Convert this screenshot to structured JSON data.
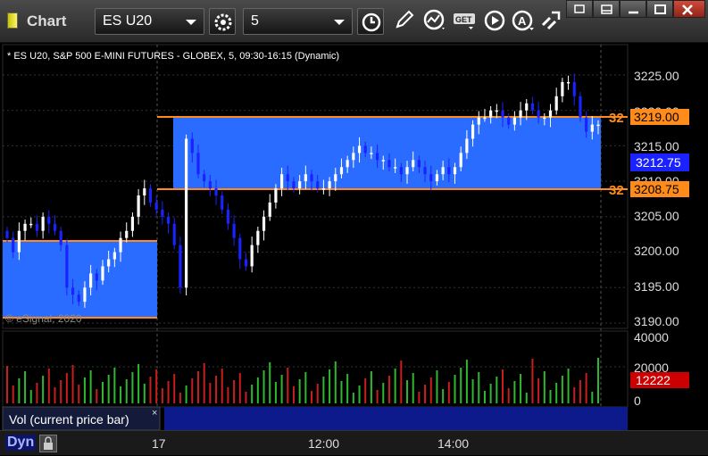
{
  "toolbar": {
    "title": "Chart",
    "symbol": "ES U20",
    "interval": "5"
  },
  "chart": {
    "header": "* ES U20, S&P 500 E-MINI FUTURES - GLOBEX, 5, 09:30-16:15 (Dynamic)",
    "watermark": "© eSignal, 2020",
    "price_labels": [
      "3225.00",
      "3220.00",
      "3215.00",
      "3210.00",
      "3205.00",
      "3200.00",
      "3195.00",
      "3190.00"
    ],
    "upper_tag": "3219.00",
    "lower_tag": "3208.75",
    "current_price": "3212.75",
    "upper_tag_prefix": "32",
    "lower_tag_prefix": "32",
    "zone_color": "#2a6cff",
    "line_color": "#ff8c1a",
    "up_color": "#ffffff",
    "down_color": "#1a22ff"
  },
  "volume": {
    "title": "Vol (current price bar)",
    "labels": [
      "40000",
      "20000",
      "0"
    ],
    "current": "12222",
    "tag_color": "#cc0000"
  },
  "time_axis": {
    "labels": [
      "17",
      "12:00",
      "14:00"
    ]
  },
  "footer": {
    "mode": "Dyn"
  },
  "chart_data": {
    "type": "candlestick",
    "price_axis": [
      3190,
      3225
    ],
    "levels": {
      "resistance": 3219.0,
      "support": 3208.75,
      "prior_high": 3201.5,
      "prior_low": 3190.5,
      "last": 3212.75
    },
    "candles_close": [
      3202,
      3200,
      3203,
      3204,
      3204,
      3203,
      3205,
      3204,
      3203,
      3201,
      3195,
      3194,
      3193,
      3195,
      3197,
      3196,
      3198,
      3199,
      3200,
      3202,
      3203,
      3205,
      3208,
      3209,
      3207,
      3206,
      3205,
      3204,
      3201,
      3195,
      3216,
      3214,
      3211,
      3210,
      3209,
      3208,
      3206,
      3204,
      3202,
      3199,
      3198,
      3201,
      3203,
      3205,
      3207,
      3209,
      3211,
      3210,
      3209,
      3210,
      3211,
      3210,
      3209,
      3209,
      3210,
      3211,
      3212,
      3213,
      3214,
      3215,
      3214,
      3214,
      3213,
      3213,
      3212,
      3212,
      3211,
      3212,
      3213,
      3212,
      3211,
      3210,
      3211,
      3212,
      3211,
      3212,
      3214,
      3216,
      3218,
      3219,
      3219,
      3220,
      3220,
      3219,
      3218,
      3219,
      3220,
      3221,
      3220,
      3219,
      3219,
      3220,
      3222,
      3224,
      3224,
      3222,
      3219,
      3217,
      3218,
      3218
    ],
    "volume_max": 40000
  }
}
